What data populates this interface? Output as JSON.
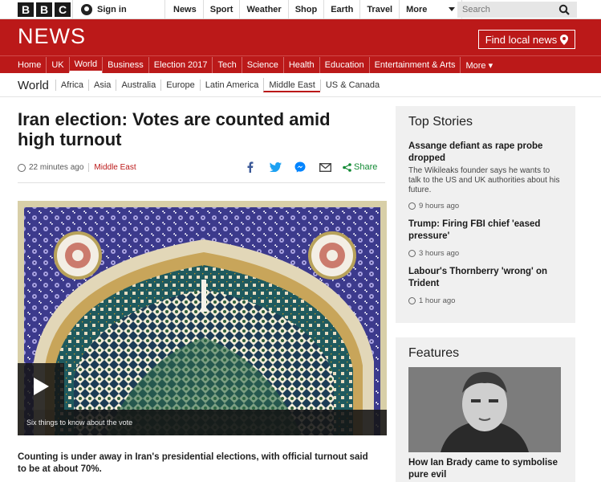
{
  "brand": {
    "letters": [
      "B",
      "B",
      "C"
    ]
  },
  "topbar": {
    "signin_label": "Sign in",
    "nav": [
      "News",
      "Sport",
      "Weather",
      "Shop",
      "Earth",
      "Travel"
    ],
    "more_label": "More",
    "search_placeholder": "Search"
  },
  "news": {
    "logo": "NEWS",
    "find_local": "Find local news"
  },
  "section_nav": [
    "Home",
    "UK",
    "World",
    "Business",
    "Election 2017",
    "Tech",
    "Science",
    "Health",
    "Education",
    "Entertainment & Arts",
    "More ▾"
  ],
  "section_nav_active": "World",
  "subnav": {
    "lead": "World",
    "items": [
      "Africa",
      "Asia",
      "Australia",
      "Europe",
      "Latin America",
      "Middle East",
      "US & Canada"
    ],
    "active": "Middle East"
  },
  "article": {
    "headline": "Iran election: Votes are counted amid high turnout",
    "time": "22 minutes ago",
    "section": "Middle East",
    "share_label": "Share",
    "video_caption": "Six things to know about the vote",
    "intro": "Counting is under away in Iran's presidential elections, with official turnout said to be at about 70%."
  },
  "top_stories": {
    "title": "Top Stories",
    "items": [
      {
        "title": "Assange defiant as rape probe dropped",
        "summary": "The Wikileaks founder says he wants to talk to the US and UK authorities about his future.",
        "time": "9 hours ago"
      },
      {
        "title": "Trump: Firing FBI chief 'eased pressure'",
        "summary": "",
        "time": "3 hours ago"
      },
      {
        "title": "Labour's Thornberry 'wrong' on Trident",
        "summary": "",
        "time": "1 hour ago"
      }
    ]
  },
  "features": {
    "title": "Features",
    "item_title": "How Ian Brady came to symbolise pure evil"
  },
  "colors": {
    "brand_red": "#bb1919",
    "share_green": "#128a34",
    "panel_bg": "#f0f0f0"
  }
}
